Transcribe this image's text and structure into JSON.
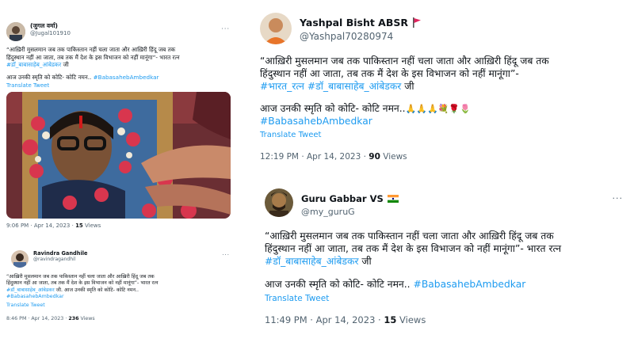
{
  "tweet1": {
    "display_name": "(जुगल वर्मा)",
    "handle": "@Jugal101910",
    "text_line1": "“आख़िरी मुसलमान जब तक पाकिस्तान नहीं चला जाता और आख़िरी हिंदू जब तक",
    "text_line2": "हिंदुस्थान नहीं आ जाता, तब तक मैं देश के इस विभाजन को नहीं मानूंगा”- भारत रत्न",
    "hashtag1": "#डॉ_बाबासाहेब_आंबेडकर",
    "text_after_hashtag1": " जी",
    "text2": "आज उनकी स्मृति को कोटि- कोटि नमन..",
    "hashtag2": "#BabasahebAmbedkar",
    "translate": "Translate Tweet",
    "time": "9:06 PM · Apr 14, 2023 · ",
    "views_count": "15",
    "views_label": " Views",
    "more": "···"
  },
  "tweet2": {
    "display_name": "Ravindra Gandhile",
    "handle": "@ravindragandhil",
    "text_line1": "“आख़िरी मुसलमान जब तक पाकिस्तान नहीं चला जाता और आख़िरी हिंदू जब तक",
    "text_line2": "हिंदुस्थान नहीं आ जाता,  तब तक मैं देश के इस विभाजन को नहीं मानूंगा”-  भारत रत्न",
    "hashtag1": "#डॉ_बाबासाहेब_आंबेडकर",
    "text_after_hashtag1": " जी.  आज उनकी स्मृति को कोटि- कोटि नमन..",
    "hashtag2": "#BabasahebAmbedkar",
    "translate": "Translate Tweet",
    "time": "8:46 PM · Apr 14, 2023 · ",
    "views_count": "236",
    "views_label": " Views",
    "more": "···"
  },
  "tweet3": {
    "display_name": "Yashpal Bisht ABSR",
    "handle": "@Yashpal70280974",
    "text_line1": "“आख़िरी मुसलमान जब तक पाकिस्तान नहीं चला जाता और आख़िरी हिंदू जब तक",
    "text_line2": "हिंदुस्थान नहीं आ जाता, तब तक मैं देश के इस विभाजन को नहीं मानूंगा”-",
    "hashtag1": "#भारत_रत्न #डॉ_बाबासाहेब_आंबेडकर",
    "text_after_hashtag1": " जी",
    "text2": "आज उनकी स्मृति को कोटि- कोटि नमन..",
    "emoji": "🙏🙏🙏💐🌹🌷",
    "hashtag2": "#BabasahebAmbedkar",
    "translate": "Translate Tweet",
    "time": "12:19 PM · Apr 14, 2023 · ",
    "views_count": "90",
    "views_label": " Views"
  },
  "tweet4": {
    "display_name": "Guru Gabbar VS",
    "handle": "@my_guruG",
    "text_line1": "“आख़िरी मुसलमान जब तक पाकिस्तान नहीं चला जाता और आख़िरी हिंदू जब तक",
    "text_line2": "हिंदुस्थान नहीं आ जाता,  तब तक मैं देश के इस विभाजन को नहीं मानूंगा”-  भारत रत्न",
    "hashtag1": "#डॉ_बाबासाहेब_आंबेडकर",
    "text_after_hashtag1": " जी",
    "text2": "आज उनकी स्मृति को कोटि- कोटि नमन..",
    "hashtag2": "#BabasahebAmbedkar",
    "translate": "Translate Tweet",
    "time": "11:49 PM · Apr 14, 2023 · ",
    "views_count": "15",
    "views_label": " Views",
    "more": "···"
  },
  "colors": {
    "link": "#1d9bf0",
    "text": "#0f1419",
    "muted": "#536471",
    "flag_red": "#e0245e"
  }
}
